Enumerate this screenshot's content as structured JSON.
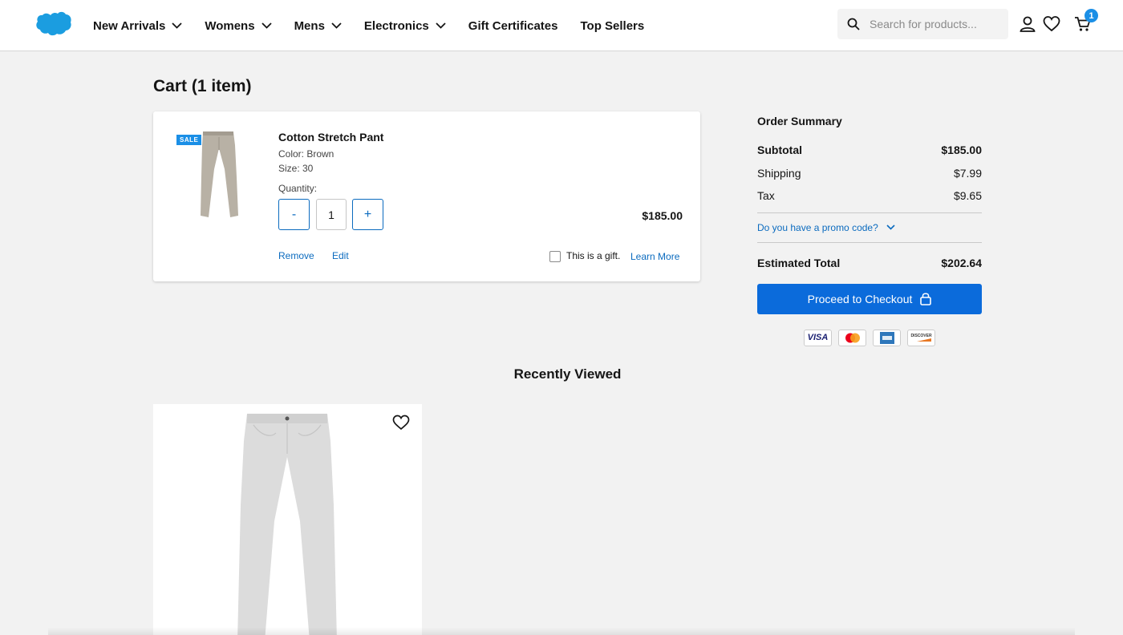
{
  "header": {
    "nav": [
      {
        "label": "New Arrivals",
        "has_dropdown": true
      },
      {
        "label": "Womens",
        "has_dropdown": true
      },
      {
        "label": "Mens",
        "has_dropdown": true
      },
      {
        "label": "Electronics",
        "has_dropdown": true
      },
      {
        "label": "Gift Certificates",
        "has_dropdown": false
      },
      {
        "label": "Top Sellers",
        "has_dropdown": false
      }
    ],
    "search": {
      "placeholder": "Search for products...",
      "value": ""
    },
    "cart_count": "1",
    "icons": [
      "search-icon",
      "account-icon",
      "wishlist-icon",
      "cart-icon"
    ],
    "accent_color": "#1b8fe6"
  },
  "cart": {
    "title": "Cart (1 item)",
    "item": {
      "badge": "SALE",
      "name": "Cotton Stretch Pant",
      "color": "Color: Brown",
      "size": "Size: 30",
      "quantity_label": "Quantity:",
      "decrement": "-",
      "quantity": "1",
      "increment": "+",
      "price": "$185.00",
      "remove": "Remove",
      "edit": "Edit",
      "gift_label": "This is a gift.",
      "learn_more": "Learn More"
    }
  },
  "summary": {
    "title": "Order Summary",
    "subtotal_label": "Subtotal",
    "subtotal": "$185.00",
    "shipping_label": "Shipping",
    "shipping": "$7.99",
    "tax_label": "Tax",
    "tax": "$9.65",
    "promo": "Do you have a promo code?",
    "estimated_label": "Estimated Total",
    "estimated": "$202.64",
    "checkout": "Proceed to Checkout",
    "payment_cards": [
      "VISA",
      "Mastercard",
      "American Express",
      "DISCOVER"
    ],
    "primary_color": "#0b6bdb"
  },
  "recent": {
    "title": "Recently Viewed"
  }
}
